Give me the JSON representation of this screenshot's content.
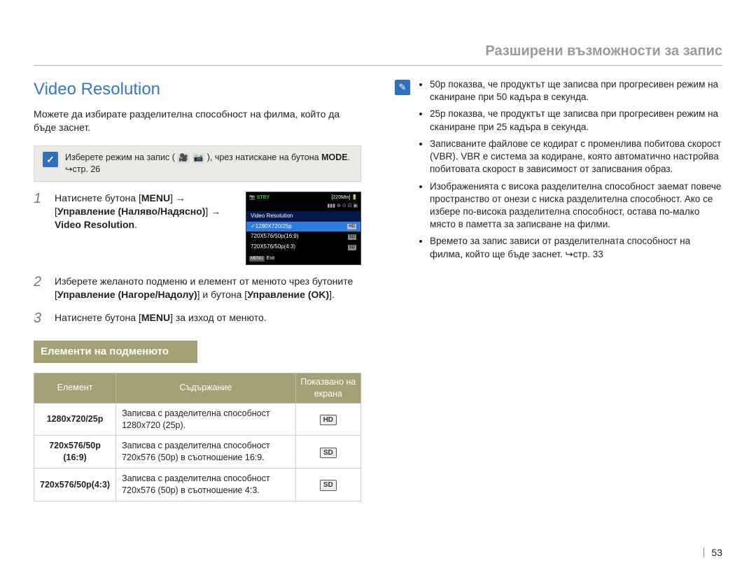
{
  "header": {
    "running": "Разширени възможности за запис"
  },
  "section": {
    "title": "Video Resolution"
  },
  "intro": "Можете да избирате разделителна способност на филма, който да бъде заснет.",
  "notebox": {
    "pre": "Изберете режим на запис ( ",
    "mid": " ), чрез натискане на бутона ",
    "mode": "MODE",
    "post": ". ↪стр. 26"
  },
  "steps": {
    "s1": {
      "a": "Натиснете бутона [",
      "menu": "MENU",
      "b": "] → [",
      "ctrl": "Управление (Наляво/Надясно)",
      "c": "] → ",
      "vr": "Video Resolution",
      "d": "."
    },
    "s2": {
      "a": "Изберете желаното подменю и елемент от менюто чрез бутоните [",
      "ctrl": "Управление (Нагоре/Надолу)",
      "b": "] и бутона [",
      "ok": "Управление (OK)",
      "c": "]."
    },
    "s3": {
      "a": "Натиснете бутона [",
      "menu": "MENU",
      "b": "] за изход от менюто."
    }
  },
  "lcd": {
    "stby": "STBY",
    "time": "[220Min]",
    "title": "Video Resolution",
    "row1": "1280X720/25p",
    "row2": "720X576/50p(16:9)",
    "row3": "720X576/50p(4:3)",
    "menu": "MENU",
    "exit": "Exit"
  },
  "subhead": "Елементи на подменюто",
  "table": {
    "h1": "Елемент",
    "h2": "Съдържание",
    "h3": "Показвано на екрана",
    "r1": {
      "name": "1280x720/25p",
      "desc": "Записва с разделителна способност 1280x720 (25p).",
      "badge": "HD"
    },
    "r2": {
      "name": "720x576/50p (16:9)",
      "desc": "Записва с разделителна способност 720x576 (50p) в съотношение 16:9.",
      "badge": "SD"
    },
    "r3": {
      "name": "720x576/50p(4:3)",
      "desc": "Записва с разделителна способност 720x576 (50p) в съотношение 4:3.",
      "badge": "SD"
    }
  },
  "right_notes": {
    "b1": "50p показва, че продуктът ще записва при прогресивен режим на сканиране при 50 кадъра в секунда.",
    "b2": "25p показва, че продуктът ще записва при прогресивен режим на сканиране при 25 кадъра в секунда.",
    "b3": "Записваните файлове се кодират с променлива побитова скорост (VBR). VBR е система за кодиране, която автоматично настройва побитовата скорост в зависимост от записвания образ.",
    "b4": "Изображенията с висока разделителна способност заемат повече пространство от онези с ниска разделителна способност. Ако се избере по-висока разделителна способност, остава по-малко място в паметта за записване на филми.",
    "b5": "Времето за запис зависи от разделителната способност на филма, който ще бъде заснет. ↪стр. 33"
  },
  "page_number": "53"
}
